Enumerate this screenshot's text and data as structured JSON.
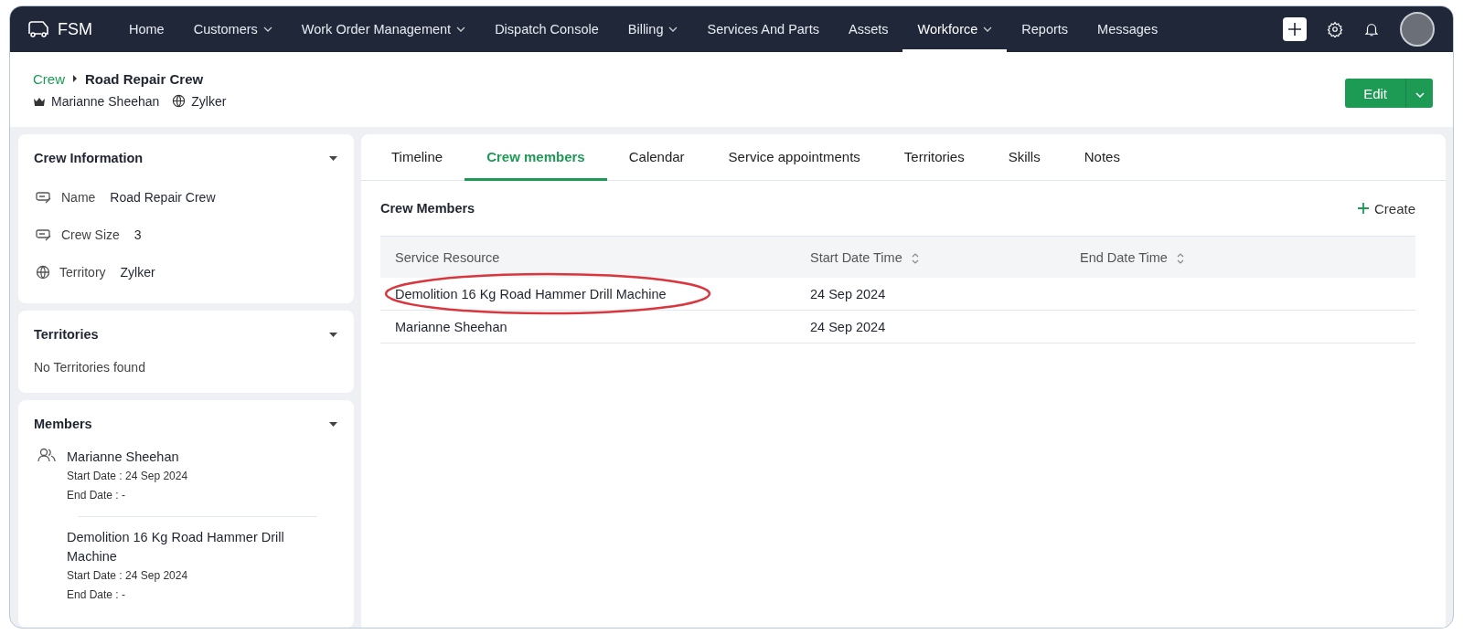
{
  "app": {
    "name": "FSM"
  },
  "nav": [
    {
      "label": "Home",
      "dropdown": false,
      "selected": false
    },
    {
      "label": "Customers",
      "dropdown": true,
      "selected": false
    },
    {
      "label": "Work Order Management",
      "dropdown": true,
      "selected": false
    },
    {
      "label": "Dispatch Console",
      "dropdown": false,
      "selected": false
    },
    {
      "label": "Billing",
      "dropdown": true,
      "selected": false
    },
    {
      "label": "Services And Parts",
      "dropdown": false,
      "selected": false
    },
    {
      "label": "Assets",
      "dropdown": false,
      "selected": false
    },
    {
      "label": "Workforce",
      "dropdown": true,
      "selected": true
    },
    {
      "label": "Reports",
      "dropdown": false,
      "selected": false
    },
    {
      "label": "Messages",
      "dropdown": false,
      "selected": false
    }
  ],
  "header": {
    "breadcrumb": "Crew",
    "title": "Road Repair Crew",
    "owner": "Marianne Sheehan",
    "territory": "Zylker",
    "edit_button": "Edit"
  },
  "crew_information": {
    "title": "Crew Information",
    "fields": [
      {
        "kind": "text",
        "label": "Name",
        "value": "Road Repair Crew"
      },
      {
        "kind": "text",
        "label": "Crew Size",
        "value": "3"
      },
      {
        "kind": "territory",
        "label": "Territory",
        "value": "Zylker"
      }
    ]
  },
  "territories": {
    "title": "Territories",
    "empty": "No Territories found"
  },
  "members": {
    "title": "Members",
    "items": [
      {
        "name": "Marianne Sheehan",
        "kind": "person",
        "start": "Start Date : 24 Sep 2024",
        "end": "End Date : -"
      },
      {
        "name": "Demolition 16 Kg Road Hammer Drill Machine",
        "kind": "equipment",
        "start": "Start Date : 24 Sep 2024",
        "end": "End Date : -"
      }
    ]
  },
  "tabs": [
    {
      "label": "Timeline",
      "selected": false
    },
    {
      "label": "Crew members",
      "selected": true
    },
    {
      "label": "Calendar",
      "selected": false
    },
    {
      "label": "Service appointments",
      "selected": false
    },
    {
      "label": "Territories",
      "selected": false
    },
    {
      "label": "Skills",
      "selected": false
    },
    {
      "label": "Notes",
      "selected": false
    }
  ],
  "table": {
    "title": "Crew Members",
    "create": "Create",
    "columns": [
      {
        "label": "Service Resource",
        "sortable": false
      },
      {
        "label": "Start Date Time",
        "sortable": true
      },
      {
        "label": "End Date Time",
        "sortable": true
      }
    ],
    "rows": [
      {
        "cells": [
          "Demolition 16 Kg Road Hammer Drill Machine",
          "24 Sep 2024"
        ],
        "circled": true
      },
      {
        "cells": [
          "Marianne Sheehan",
          "24 Sep 2024"
        ],
        "circled": false
      }
    ]
  }
}
